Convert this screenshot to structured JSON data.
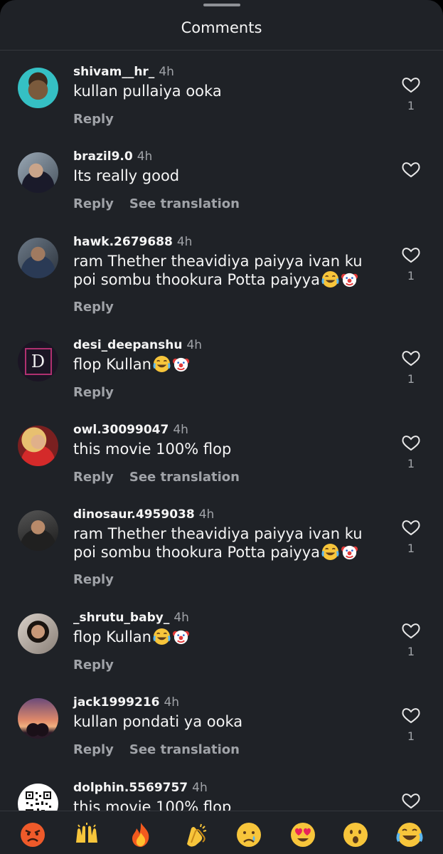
{
  "header": {
    "title": "Comments"
  },
  "reply_label": "Reply",
  "see_translation_label": "See translation",
  "comments": [
    {
      "username": "shivam__hr_",
      "time": "4h",
      "text": "kullan pullaiya ooka",
      "likes": "1",
      "avatar_icon": "avatar-photo-icon"
    },
    {
      "username": "brazil9.0",
      "time": "4h",
      "text": "Its really good",
      "likes": "",
      "avatar_icon": "avatar-photo-icon"
    },
    {
      "username": "hawk.2679688",
      "time": "4h",
      "text": "ram Thether theavidiya paiyya ivan ku poi sombu thookura Potta paiyya",
      "emojis": [
        "joy-emoji-icon",
        "clown-emoji-icon"
      ],
      "likes": "1",
      "avatar_icon": "avatar-photo-icon"
    },
    {
      "username": "desi_deepanshu",
      "time": "4h",
      "text": "flop Kullan",
      "emojis": [
        "joy-emoji-icon",
        "clown-emoji-icon"
      ],
      "likes": "1",
      "avatar_icon": "letter-d-logo-icon"
    },
    {
      "username": "owl.30099047",
      "time": "4h",
      "text": "this movie 100% flop",
      "likes": "1",
      "avatar_icon": "avatar-photo-icon"
    },
    {
      "username": "dinosaur.4959038",
      "time": "4h",
      "text": "ram Thether theavidiya paiyya ivan ku poi sombu thookura Potta paiyya",
      "emojis": [
        "joy-emoji-icon",
        "clown-emoji-icon"
      ],
      "likes": "1",
      "avatar_icon": "avatar-photo-icon"
    },
    {
      "username": "_shrutu_baby_",
      "time": "4h",
      "text": "flop Kullan",
      "emojis": [
        "joy-emoji-icon",
        "clown-emoji-icon"
      ],
      "likes": "1",
      "avatar_icon": "avatar-photo-icon"
    },
    {
      "username": "jack1999216",
      "time": "4h",
      "text": "kullan pondati ya ooka",
      "likes": "1",
      "avatar_icon": "sunset-photo-icon"
    },
    {
      "username": "dolphin.5569757",
      "time": "4h",
      "text": "this movie 100% flop",
      "likes": "",
      "avatar_icon": "qr-code-icon"
    }
  ],
  "letter_avatar": "D",
  "reactions": [
    "angry-face-emoji-icon",
    "raised-hands-emoji-icon",
    "fire-emoji-icon",
    "clapping-hands-emoji-icon",
    "crying-face-emoji-icon",
    "heart-eyes-emoji-icon",
    "surprised-face-emoji-icon",
    "joy-emoji-icon"
  ],
  "colors": {
    "background": "#1f2227",
    "text_primary": "#f5f5f5",
    "text_secondary": "#a0a3a8",
    "divider": "#34373d"
  }
}
